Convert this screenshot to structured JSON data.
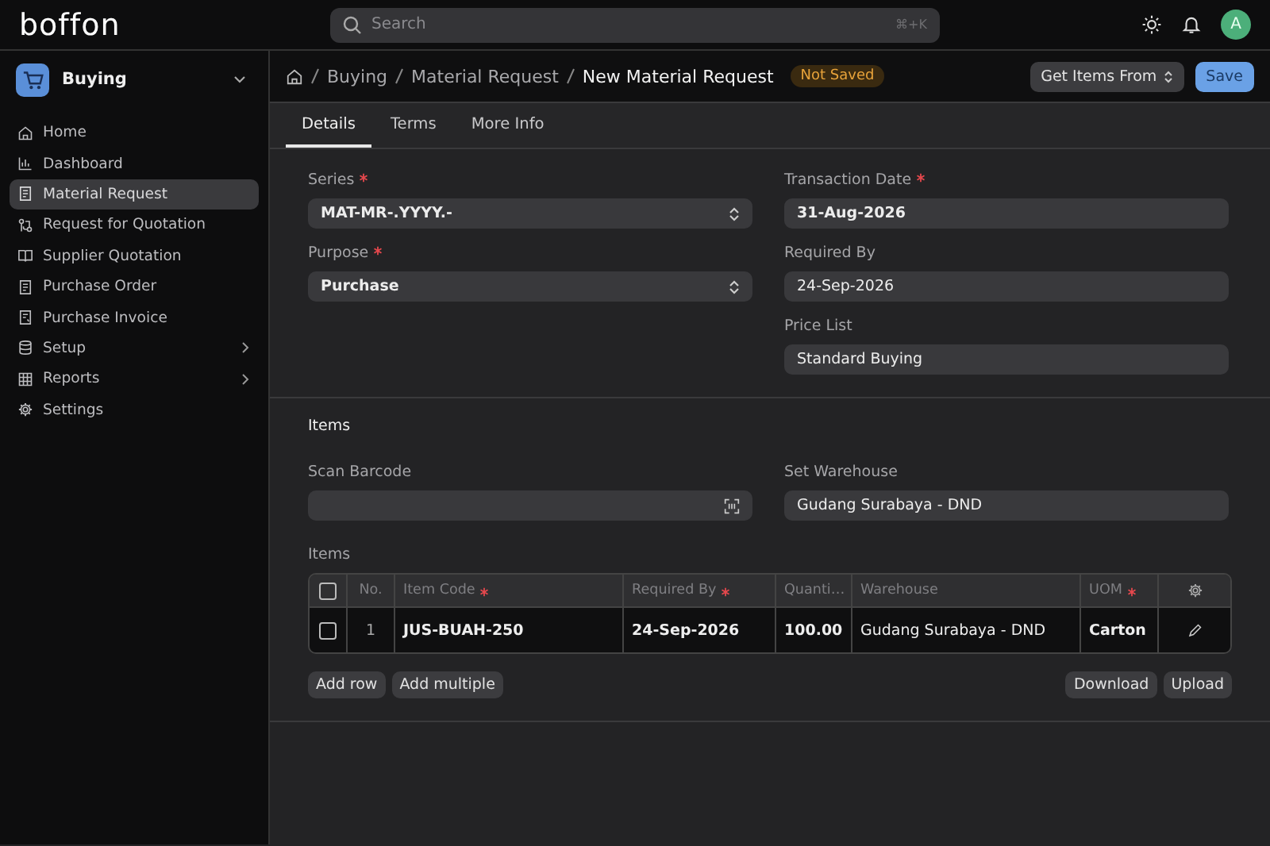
{
  "topbar": {
    "logo": "boffon",
    "search": {
      "placeholder": "Search",
      "shortcut": "⌘+K"
    },
    "avatar": "A"
  },
  "sidebar": {
    "module": "Buying",
    "items": [
      {
        "label": "Home",
        "selected": false,
        "has_children": false
      },
      {
        "label": "Dashboard",
        "selected": false,
        "has_children": false
      },
      {
        "label": "Material Request",
        "selected": true,
        "has_children": false
      },
      {
        "label": "Request for Quotation",
        "selected": false,
        "has_children": false
      },
      {
        "label": "Supplier Quotation",
        "selected": false,
        "has_children": false
      },
      {
        "label": "Purchase Order",
        "selected": false,
        "has_children": false
      },
      {
        "label": "Purchase Invoice",
        "selected": false,
        "has_children": false
      },
      {
        "label": "Setup",
        "selected": false,
        "has_children": true
      },
      {
        "label": "Reports",
        "selected": false,
        "has_children": true
      },
      {
        "label": "Settings",
        "selected": false,
        "has_children": false
      }
    ]
  },
  "header": {
    "breadcrumbs": [
      "Buying",
      "Material Request"
    ],
    "title": "New Material Request",
    "status": "Not Saved",
    "actions": [
      {
        "label": "Get Items From",
        "kind": "dropdown"
      },
      {
        "label": "Save",
        "kind": "primary"
      }
    ]
  },
  "tabs": [
    {
      "label": "Details",
      "selected": true
    },
    {
      "label": "Terms",
      "selected": false
    },
    {
      "label": "More Info",
      "selected": false
    }
  ],
  "details": {
    "left": [
      {
        "label": "Series",
        "required": true,
        "value": "MAT-MR-.YYYY.-",
        "kind": "select"
      },
      {
        "label": "Purpose",
        "required": true,
        "value": "Purchase",
        "kind": "select"
      }
    ],
    "right": [
      {
        "label": "Transaction Date",
        "required": true,
        "value": "31-Aug-2026",
        "kind": "text"
      },
      {
        "label": "Required By",
        "required": false,
        "value": "24-Sep-2026",
        "kind": "text"
      },
      {
        "label": "Price List",
        "required": false,
        "value": "Standard Buying",
        "kind": "text"
      }
    ]
  },
  "items_section": {
    "title": "Items",
    "scan_barcode": {
      "label": "Scan Barcode"
    },
    "set_warehouse": {
      "label": "Set Warehouse",
      "value": "Gudang Surabaya - DND"
    },
    "table": {
      "label": "Items",
      "select_all_checked": false,
      "columns": [
        {
          "label": "No.",
          "required": false
        },
        {
          "label": "Item Code",
          "required": true
        },
        {
          "label": "Required By",
          "required": true
        },
        {
          "label": "Quanti…",
          "required": false
        },
        {
          "label": "Warehouse",
          "required": false
        },
        {
          "label": "UOM",
          "required": true
        }
      ],
      "rows": [
        {
          "checked": false,
          "cells": [
            "1",
            "JUS-BUAH-250",
            "24-Sep-2026",
            "100.00",
            "Gudang Surabaya - DND",
            "Carton"
          ]
        }
      ]
    },
    "left_buttons": [
      "Add row",
      "Add multiple"
    ],
    "right_buttons": [
      "Download",
      "Upload"
    ]
  }
}
